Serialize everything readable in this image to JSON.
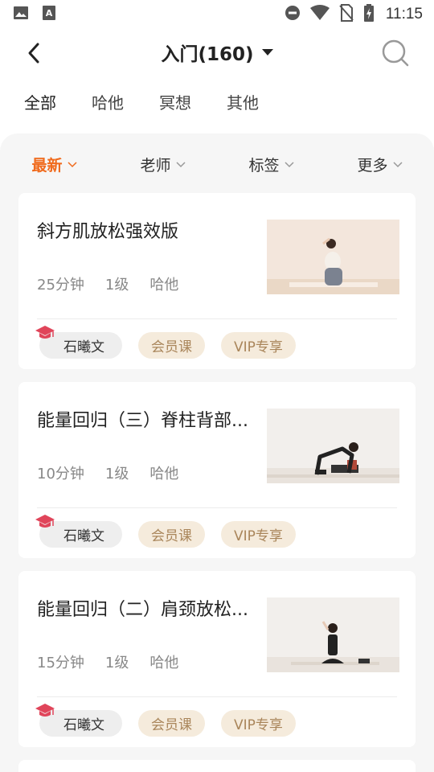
{
  "status_bar": {
    "time": "11:15",
    "icons": [
      "image-icon",
      "text-a-icon",
      "do-not-disturb-icon",
      "wifi-icon",
      "no-sim-icon",
      "battery-charging-icon"
    ]
  },
  "header": {
    "title": "入门(160)",
    "back_icon": "chevron-left-icon",
    "dropdown_icon": "caret-down-icon",
    "search_icon": "search-icon"
  },
  "category_tabs": [
    {
      "label": "全部",
      "active": true
    },
    {
      "label": "哈他",
      "active": false
    },
    {
      "label": "冥想",
      "active": false
    },
    {
      "label": "其他",
      "active": false
    }
  ],
  "filters": [
    {
      "label": "最新",
      "active": true
    },
    {
      "label": "老师",
      "active": false
    },
    {
      "label": "标签",
      "active": false
    },
    {
      "label": "更多",
      "active": false
    }
  ],
  "courses": [
    {
      "title": "斜方肌放松强效版",
      "duration": "25分钟",
      "level": "1级",
      "style": "哈他",
      "teacher": "石曦文",
      "tags": [
        "会员课",
        "VIP专享"
      ],
      "thumbnail": "yoga-seated-neck-stretch"
    },
    {
      "title": "能量回归（三）脊柱背部...",
      "duration": "10分钟",
      "level": "1级",
      "style": "哈他",
      "teacher": "石曦文",
      "tags": [
        "会员课",
        "VIP专享"
      ],
      "thumbnail": "yoga-tabletop-pose"
    },
    {
      "title": "能量回归（二）肩颈放松...",
      "duration": "15分钟",
      "level": "1级",
      "style": "哈他",
      "teacher": "石曦文",
      "tags": [
        "会员课",
        "VIP专享"
      ],
      "thumbnail": "yoga-cross-legged-neck-stretch"
    }
  ],
  "colors": {
    "accent": "#f06a1c",
    "tab_underline": "#f6c4a5",
    "tag_bg": "#f5ebdc",
    "tag_text": "#a9855a",
    "cap_icon": "#e0455a"
  }
}
